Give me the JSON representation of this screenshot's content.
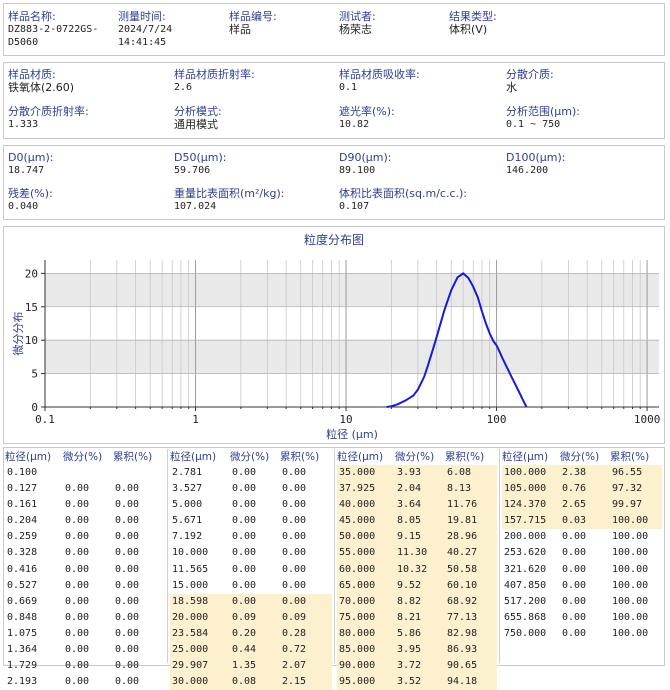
{
  "sample_info": [
    {
      "label": "样品名称:",
      "value": "DZ883-2-0722GS-\nD5060"
    },
    {
      "label": "测量时间:",
      "value": "2024/7/24\n14:41:45"
    },
    {
      "label": "样品编号:",
      "value": "样品"
    },
    {
      "label": "测试者:",
      "value": "杨荣志"
    },
    {
      "label": "结果类型:",
      "value": "体积(V)"
    }
  ],
  "params": [
    {
      "label": "样品材质:",
      "value": "铁氧体(2.60)"
    },
    {
      "label": "样品材质折射率:",
      "value": "2.6"
    },
    {
      "label": "样品材质吸收率:",
      "value": "0.1"
    },
    {
      "label": "分散介质:",
      "value": "水"
    },
    {
      "label": "分散介质折射率:",
      "value": "1.333"
    },
    {
      "label": "分析模式:",
      "value": "通用模式"
    },
    {
      "label": "遮光率(%):",
      "value": "10.82"
    },
    {
      "label": "分析范围(μm):",
      "value": "0.1 ~ 750"
    }
  ],
  "results": [
    {
      "label": "D0(μm):",
      "value": "18.747"
    },
    {
      "label": "D50(μm):",
      "value": "59.706"
    },
    {
      "label": "D90(μm):",
      "value": "89.100"
    },
    {
      "label": "D100(μm):",
      "value": "146.200"
    },
    {
      "label": "残差(%):",
      "value": "0.040"
    },
    {
      "label": "重量比表面积(m²/kg):",
      "value": "107.024"
    },
    {
      "label": "体积比表面积(sq.m/c.c.):",
      "value": "0.107"
    }
  ],
  "colors": {
    "curve": "#1a1ad6",
    "label": "#2e3f8f",
    "highlight": "#fcf0cf",
    "band": "#e9e9e9"
  },
  "chart_data": {
    "type": "line",
    "title": "粒度分布图",
    "xlabel": "粒径 (μm)",
    "ylabel": "微分分布",
    "xscale": "log",
    "xlim": [
      0.1,
      1200
    ],
    "ylim": [
      0,
      22
    ],
    "x_ticks": [
      "0.1",
      "1",
      "10",
      "100",
      "1000"
    ],
    "y_ticks": [
      "0",
      "5",
      "10",
      "15",
      "20"
    ],
    "grid": true,
    "series": [
      {
        "x": [
          18.6,
          20,
          22,
          25,
          28,
          30,
          33,
          35,
          38,
          40,
          45,
          50,
          55,
          60,
          65,
          70,
          75,
          80,
          85,
          90,
          95,
          100,
          105,
          110,
          124,
          140,
          150,
          158
        ],
        "y": [
          0,
          0.1,
          0.4,
          1.0,
          1.7,
          2.6,
          4.5,
          6.2,
          8.8,
          10.5,
          14.5,
          17.5,
          19.4,
          20.0,
          19.3,
          18.0,
          16.4,
          14.3,
          12.5,
          11.0,
          9.9,
          9.2,
          8.2,
          7.2,
          4.8,
          2.4,
          1.0,
          0
        ]
      }
    ]
  },
  "table": {
    "headers": [
      "粒径(μm)",
      "微分(%)",
      "累积(%)"
    ],
    "columns": [
      [
        [
          "0.100",
          "",
          ""
        ],
        [
          "0.127",
          "0.00",
          "0.00"
        ],
        [
          "0.161",
          "0.00",
          "0.00"
        ],
        [
          "0.204",
          "0.00",
          "0.00"
        ],
        [
          "0.259",
          "0.00",
          "0.00"
        ],
        [
          "0.328",
          "0.00",
          "0.00"
        ],
        [
          "0.416",
          "0.00",
          "0.00"
        ],
        [
          "0.527",
          "0.00",
          "0.00"
        ],
        [
          "0.669",
          "0.00",
          "0.00"
        ],
        [
          "0.848",
          "0.00",
          "0.00"
        ],
        [
          "1.075",
          "0.00",
          "0.00"
        ],
        [
          "1.364",
          "0.00",
          "0.00"
        ],
        [
          "1.729",
          "0.00",
          "0.00"
        ],
        [
          "2.193",
          "0.00",
          "0.00"
        ]
      ],
      [
        [
          "2.781",
          "0.00",
          "0.00"
        ],
        [
          "3.527",
          "0.00",
          "0.00"
        ],
        [
          "5.000",
          "0.00",
          "0.00"
        ],
        [
          "5.671",
          "0.00",
          "0.00"
        ],
        [
          "7.192",
          "0.00",
          "0.00"
        ],
        [
          "10.000",
          "0.00",
          "0.00"
        ],
        [
          "11.565",
          "0.00",
          "0.00"
        ],
        [
          "15.000",
          "0.00",
          "0.00"
        ],
        [
          "18.598",
          "0.00",
          "0.00"
        ],
        [
          "20.000",
          "0.09",
          "0.09"
        ],
        [
          "23.584",
          "0.20",
          "0.28"
        ],
        [
          "25.000",
          "0.44",
          "0.72"
        ],
        [
          "29.907",
          "1.35",
          "2.07"
        ],
        [
          "30.000",
          "0.08",
          "2.15"
        ]
      ],
      [
        [
          "35.000",
          "3.93",
          "6.08"
        ],
        [
          "37.925",
          "2.04",
          "8.13"
        ],
        [
          "40.000",
          "3.64",
          "11.76"
        ],
        [
          "45.000",
          "8.05",
          "19.81"
        ],
        [
          "50.000",
          "9.15",
          "28.96"
        ],
        [
          "55.000",
          "11.30",
          "40.27"
        ],
        [
          "60.000",
          "10.32",
          "50.58"
        ],
        [
          "65.000",
          "9.52",
          "60.10"
        ],
        [
          "70.000",
          "8.82",
          "68.92"
        ],
        [
          "75.000",
          "8.21",
          "77.13"
        ],
        [
          "80.000",
          "5.86",
          "82.98"
        ],
        [
          "85.000",
          "3.95",
          "86.93"
        ],
        [
          "90.000",
          "3.72",
          "90.65"
        ],
        [
          "95.000",
          "3.52",
          "94.18"
        ]
      ],
      [
        [
          "100.000",
          "2.38",
          "96.55"
        ],
        [
          "105.000",
          "0.76",
          "97.32"
        ],
        [
          "124.370",
          "2.65",
          "99.97"
        ],
        [
          "157.715",
          "0.03",
          "100.00"
        ],
        [
          "200.000",
          "0.00",
          "100.00"
        ],
        [
          "253.620",
          "0.00",
          "100.00"
        ],
        [
          "321.620",
          "0.00",
          "100.00"
        ],
        [
          "407.850",
          "0.00",
          "100.00"
        ],
        [
          "517.200",
          "0.00",
          "100.00"
        ],
        [
          "655.868",
          "0.00",
          "100.00"
        ],
        [
          "750.000",
          "0.00",
          "100.00"
        ]
      ]
    ],
    "highlighted": [
      [],
      [
        8,
        9,
        10,
        11,
        12,
        13
      ],
      [
        0,
        1,
        2,
        3,
        4,
        5,
        6,
        7,
        8,
        9,
        10,
        11,
        12,
        13
      ],
      [
        0,
        1,
        2,
        3
      ]
    ]
  }
}
